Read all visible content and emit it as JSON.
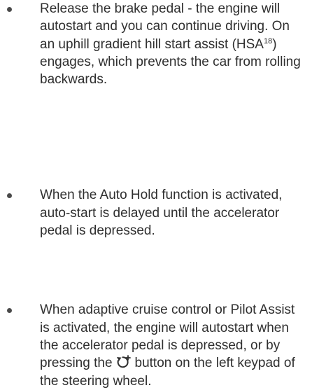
{
  "bullets": [
    {
      "text_before": "Release the brake pedal - the engine will autostart and you can continue driving. On an uphill gradient hill start assist (HSA",
      "footnote": "18",
      "text_after": ") engages, which prevents the car from rolling backwards."
    },
    {
      "text": "When the Auto Hold function is activated, auto-start is delayed until the accelerator pedal is depressed."
    },
    {
      "text_before": "When adaptive cruise control or Pilot Assist is activated, the engine will autostart when the accelerator pedal is depressed, or by pressing the",
      "icon": "resume-cruise-icon",
      "text_after": "button on the left keypad of the steering wheel."
    }
  ]
}
